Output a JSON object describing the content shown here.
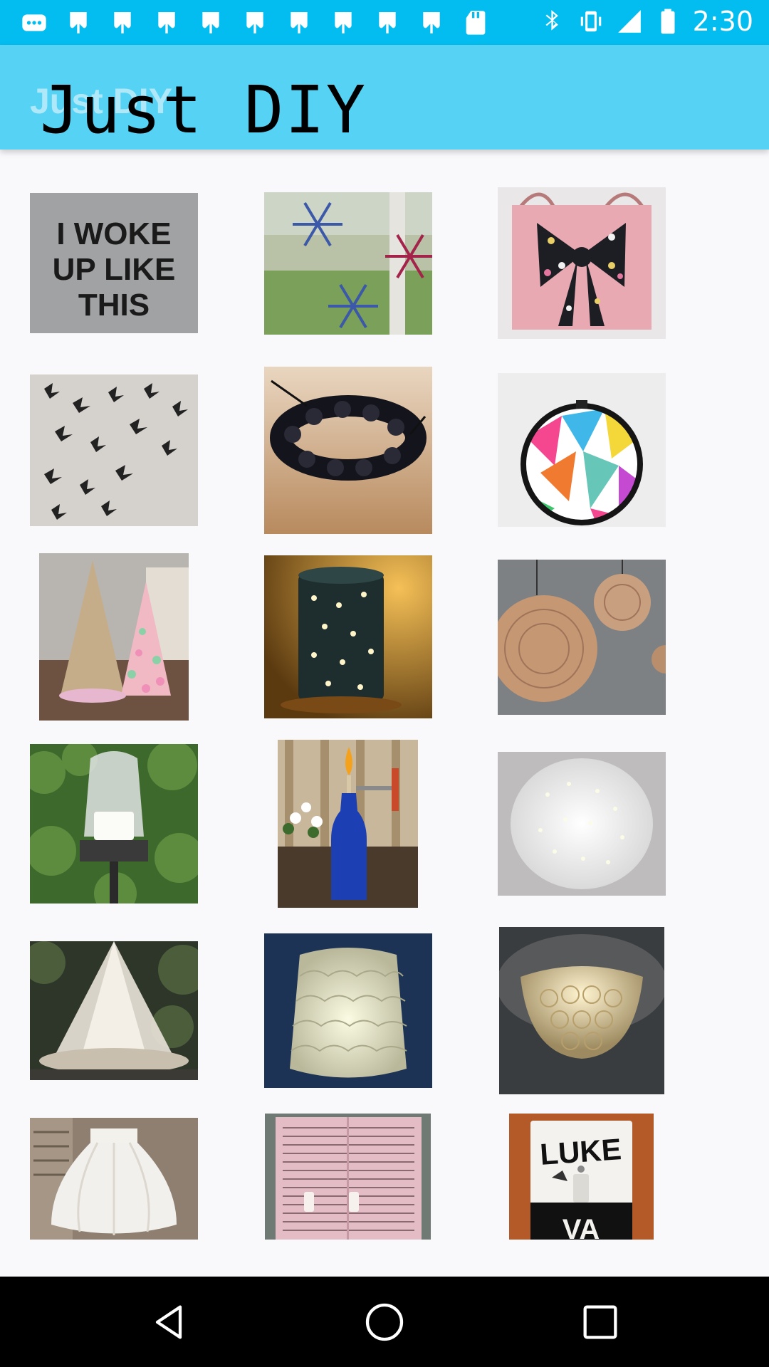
{
  "status_bar": {
    "time": "2:30",
    "notification_icons": [
      "message-icon",
      "pinterest-icon",
      "pinterest-icon",
      "pinterest-icon",
      "pinterest-icon",
      "pinterest-icon",
      "pinterest-icon",
      "pinterest-icon",
      "pinterest-icon",
      "pinterest-icon",
      "sd-card-icon"
    ],
    "system_icons": [
      "bluetooth-icon",
      "vibrate-icon",
      "signal-icon",
      "battery-icon"
    ]
  },
  "app_bar": {
    "title": "Just DIY"
  },
  "grid": {
    "items": [
      {
        "name": "woke-up-text-shirt",
        "text_lines": [
          "I WOKE",
          "UP LIKE",
          "THIS"
        ]
      },
      {
        "name": "snowflake-window-decals"
      },
      {
        "name": "pink-bag-with-bow"
      },
      {
        "name": "paper-butterfly-wall"
      },
      {
        "name": "black-beaded-bracelet"
      },
      {
        "name": "geometric-hoop-art"
      },
      {
        "name": "cone-christmas-trees"
      },
      {
        "name": "tin-can-lantern"
      },
      {
        "name": "yarn-ball-pendant-lights"
      },
      {
        "name": "garden-torch-candle"
      },
      {
        "name": "blue-bottle-tiki-torch"
      },
      {
        "name": "sparkle-lamp-shade"
      },
      {
        "name": "canopy-hanging-bed"
      },
      {
        "name": "spoon-lamp"
      },
      {
        "name": "spoon-ceiling-light"
      },
      {
        "name": "tutu-skirt"
      },
      {
        "name": "book-page-switch-plate"
      },
      {
        "name": "luke-switch-plate",
        "text_lines": [
          "LUKE",
          "VA"
        ]
      }
    ]
  },
  "nav_bar": {
    "buttons": [
      "back-icon",
      "home-icon",
      "recents-icon"
    ]
  }
}
